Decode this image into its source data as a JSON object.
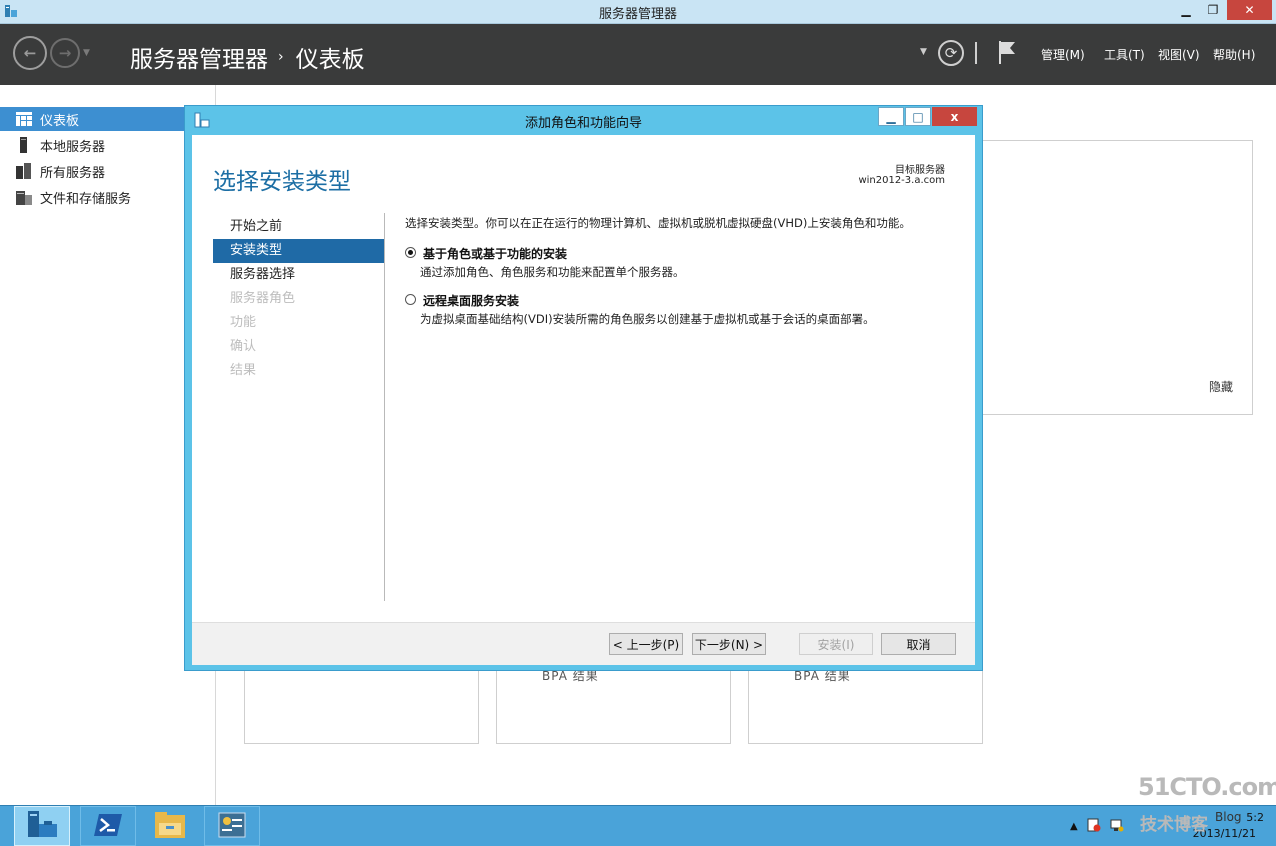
{
  "window": {
    "title": "服务器管理器"
  },
  "header": {
    "breadcrumb_root": "服务器管理器",
    "breadcrumb_sep": "›",
    "breadcrumb_page": "仪表板",
    "menus": [
      "管理(M)",
      "工具(T)",
      "视图(V)",
      "帮助(H)"
    ]
  },
  "sidebar": {
    "items": [
      {
        "label": "仪表板",
        "icon": "dashboard-icon",
        "active": true
      },
      {
        "label": "本地服务器",
        "icon": "server-icon"
      },
      {
        "label": "所有服务器",
        "icon": "servers-icon"
      },
      {
        "label": "文件和存储服务",
        "icon": "storage-icon"
      }
    ]
  },
  "dashboard": {
    "hide_label": "隐藏",
    "tiles": [
      {
        "label": ""
      },
      {
        "label": "BPA 结果"
      },
      {
        "label": "BPA 结果"
      }
    ]
  },
  "dialog": {
    "title": "添加角色和功能向导",
    "heading": "选择安装类型",
    "target_label": "目标服务器",
    "target_name": "win2012-3.a.com",
    "steps": [
      {
        "label": "开始之前",
        "state": "normal"
      },
      {
        "label": "安装类型",
        "state": "active"
      },
      {
        "label": "服务器选择",
        "state": "normal"
      },
      {
        "label": "服务器角色",
        "state": "disabled"
      },
      {
        "label": "功能",
        "state": "disabled"
      },
      {
        "label": "确认",
        "state": "disabled"
      },
      {
        "label": "结果",
        "state": "disabled"
      }
    ],
    "intro": "选择安装类型。你可以在正在运行的物理计算机、虚拟机或脱机虚拟硬盘(VHD)上安装角色和功能。",
    "options": [
      {
        "title": "基于角色或基于功能的安装",
        "desc": "通过添加角色、角色服务和功能来配置单个服务器。",
        "selected": true
      },
      {
        "title": "远程桌面服务安装",
        "desc": "为虚拟桌面基础结构(VDI)安装所需的角色服务以创建基于虚拟机或基于会话的桌面部署。",
        "selected": false
      }
    ],
    "buttons": {
      "prev": "< 上一步(P)",
      "next": "下一步(N) >",
      "install": "安装(I)",
      "cancel": "取消"
    }
  },
  "taskbar": {
    "apps": [
      "server-manager-icon",
      "powershell-icon",
      "file-explorer-icon",
      "network-icon"
    ],
    "clock_time": "5:2",
    "clock_date": "2013/11/21"
  },
  "watermark": {
    "site": "51CTO.com",
    "sub": "技术博客",
    "blog": "Blog"
  },
  "colors": {
    "accent": "#1f6aa6",
    "header_bg": "#3a3b3b",
    "dialog_frame": "#5cc3e8",
    "close_red": "#c7463e",
    "taskbar": "#4aa3d9"
  }
}
